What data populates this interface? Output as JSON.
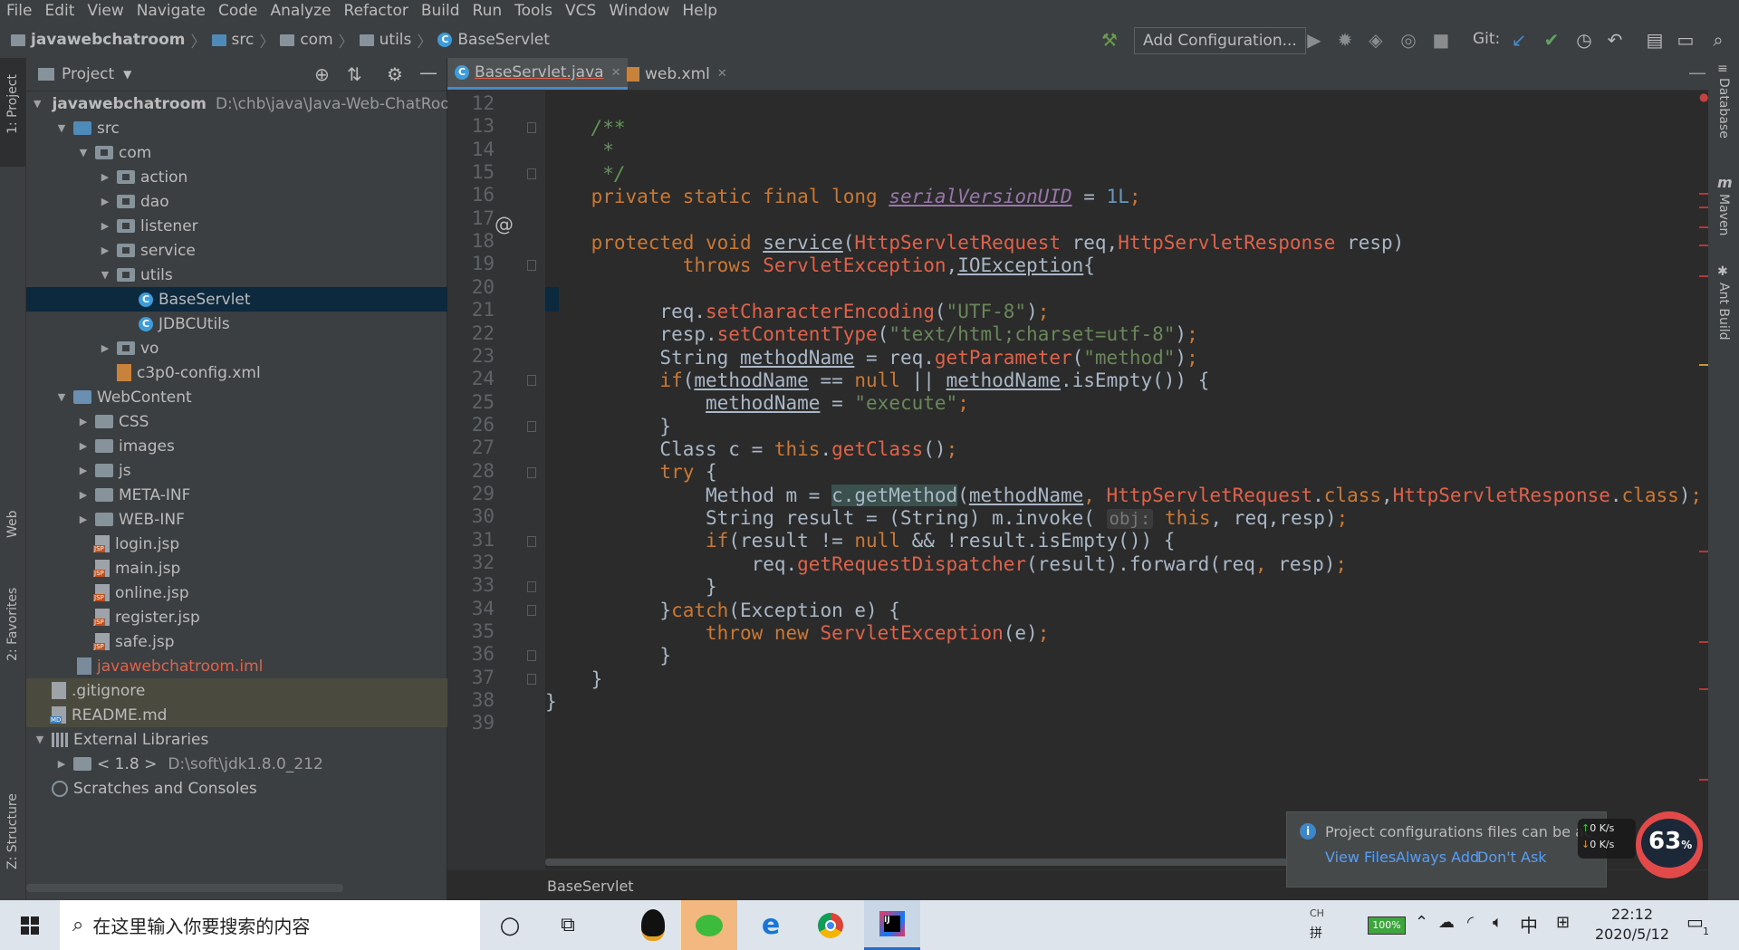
{
  "menu": [
    "File",
    "Edit",
    "View",
    "Navigate",
    "Code",
    "Analyze",
    "Refactor",
    "Build",
    "Run",
    "Tools",
    "VCS",
    "Window",
    "Help"
  ],
  "breadcrumbs": [
    "javawebchatroom",
    "src",
    "com",
    "utils",
    "BaseServlet"
  ],
  "toolbar": {
    "add_configuration": "Add Configuration...",
    "git_label": "Git:"
  },
  "left_stripe": {
    "project": "1: Project",
    "web": "Web",
    "favorites": "2: Favorites",
    "structure": "Z: Structure"
  },
  "project_panel": {
    "title": "Project",
    "tree": [
      {
        "label": "javawebchatroom",
        "extra": "D:\\chb\\java\\Java-Web-ChatRoom"
      },
      {
        "label": "src"
      },
      {
        "label": "com"
      },
      {
        "label": "action"
      },
      {
        "label": "dao"
      },
      {
        "label": "listener"
      },
      {
        "label": "service"
      },
      {
        "label": "utils"
      },
      {
        "label": "BaseServlet"
      },
      {
        "label": "JDBCUtils"
      },
      {
        "label": "vo"
      },
      {
        "label": "c3p0-config.xml"
      },
      {
        "label": "WebContent"
      },
      {
        "label": "CSS"
      },
      {
        "label": "images"
      },
      {
        "label": "js"
      },
      {
        "label": "META-INF"
      },
      {
        "label": "WEB-INF"
      },
      {
        "label": "login.jsp"
      },
      {
        "label": "main.jsp"
      },
      {
        "label": "online.jsp"
      },
      {
        "label": "register.jsp"
      },
      {
        "label": "safe.jsp"
      },
      {
        "label": "javawebchatroom.iml"
      },
      {
        "label": ".gitignore"
      },
      {
        "label": "README.md"
      },
      {
        "label": "External Libraries"
      },
      {
        "label": "< 1.8 >",
        "extra": "D:\\soft\\jdk1.8.0_212"
      },
      {
        "label": "Scratches and Consoles"
      }
    ]
  },
  "tabs": [
    {
      "label": "BaseServlet.java",
      "active": true
    },
    {
      "label": "web.xml",
      "active": false
    }
  ],
  "editor": {
    "line_numbers": [
      "12",
      "13",
      "14",
      "15",
      "16",
      "17",
      "18",
      "19",
      "20",
      "21",
      "22",
      "23",
      "24",
      "25",
      "26",
      "27",
      "28",
      "29",
      "30",
      "31",
      "32",
      "33",
      "34",
      "35",
      "36",
      "37",
      "38",
      "39"
    ],
    "breadcrumb": "BaseServlet"
  },
  "right_stripe": [
    "Database",
    "Maven",
    "Ant Build"
  ],
  "notification": {
    "text": "Project configurations files can be ac",
    "links": [
      "View Files",
      "Always Add",
      "Don't Ask"
    ]
  },
  "netmeter": {
    "up": "0  K/s",
    "down": "0  K/s",
    "percent": "63",
    "percent_sign": "%"
  },
  "taskbar": {
    "search_placeholder": "在这里输入你要搜索的内容",
    "ime_top": "CH",
    "battery": "100%",
    "lang": "中",
    "ime": "拼",
    "time": "22:12",
    "date": "2020/5/12",
    "notif_count": "1"
  },
  "colors": {
    "accent": "#4a88c7",
    "selection": "#0d293e",
    "bg": "#2b2b2b",
    "panel": "#3c3f41"
  }
}
